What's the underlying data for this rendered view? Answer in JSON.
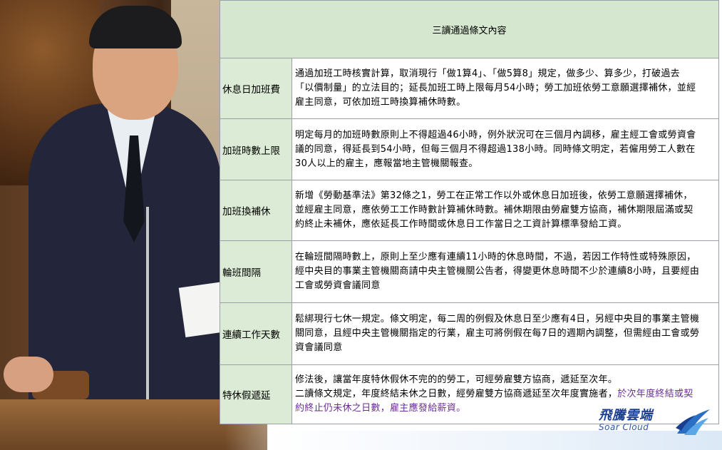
{
  "table": {
    "header": "三讀通過條文內容",
    "rows": [
      {
        "category": "休息日加班費",
        "lines": [
          "通過加班工時核實計算，取消現行「做1算4」、「做5算8」規定，做多少、算多少，打破過去",
          "「以價制量」的立法目的；延長加班工時上限每月54小時；勞工加班依勞工意願選擇補休，並經",
          "雇主同意，可依加班工時換算補休時數。"
        ]
      },
      {
        "category": "加班時數上限",
        "lines": [
          "明定每月的加班時數原則上不得超過46小時，例外狀況可在三個月內調移，雇主經工會或勞資會",
          "議的同意，得延長到54小時，但每三個月不得超過138小時。同時條文明定，若僱用勞工人數在",
          "30人以上的雇主，應報當地主管機關報查。"
        ]
      },
      {
        "category": "加班換補休",
        "lines": [
          "新增《勞動基準法》第32條之1，勞工在正常工作以外或休息日加班後，依勞工意願選擇補休，",
          "並經雇主同意，應依勞工工作時數計算補休時數。補休期限由勞雇雙方協商，補休期限屆滿或契",
          "約終止未補休，應依延長工作時間或休息日工作當日之工資計算標準發給工資。"
        ]
      },
      {
        "category": "輪班間隔",
        "lines": [
          "在輪班間隔時數上，原則上至少應有連續11小時的休息時間，不過，若因工作特性或特殊原因，",
          "經中央目的事業主管機關商請中央主管機關公告者，得變更休息時間不少於連續8小時，且要經由",
          "工會或勞資會議同意"
        ]
      },
      {
        "category": "連續工作天數",
        "lines": [
          "鬆綁現行七休一規定。條文明定，每二周的例假及休息日至少應有4日，另經中央目的事業主管機",
          "關同意，且經中央主管機關指定的行業，雇主可將例假在每7日的週期內調整，但需經由工會或勞",
          "資會議同意"
        ]
      },
      {
        "category": "特休假遞延",
        "line1": "修法後，讓當年度特休假休不完的的勞工，可經勞雇雙方協商，遞延至次年。",
        "line2_plain": "二讀條文規定，年度終結未休之日數，經勞雇雙方協商遞延至次年度實施者，",
        "line2_purple": "於次年度終結或契",
        "line3_purple": "約終止仍未休之日數，雇主應發給薪資。"
      }
    ]
  },
  "logo": {
    "name_cn": "飛騰雲端",
    "name_en": "Soar Cloud"
  },
  "colors": {
    "header_bg": "#d6e7cf",
    "category_bg": "#dcebd5",
    "highlight_text": "#6a2c9a",
    "logo_blue": "#1b3f8f"
  }
}
